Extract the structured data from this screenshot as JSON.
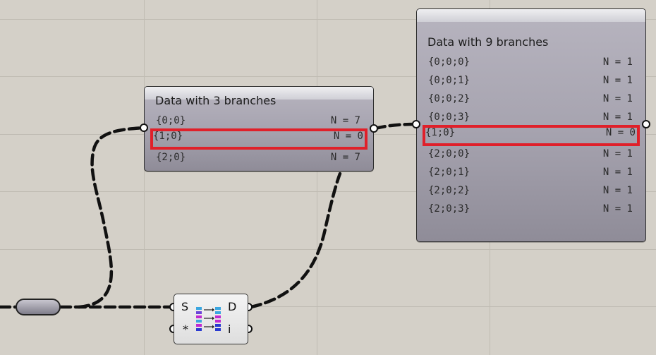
{
  "panel_small": {
    "title": "Data with 3 branches",
    "rows": [
      {
        "path": "{0;0}",
        "count": "N = 7",
        "highlighted": false
      },
      {
        "path": "{1;0}",
        "count": "N = 0",
        "highlighted": true
      },
      {
        "path": "{2;0}",
        "count": "N = 7",
        "highlighted": false
      }
    ]
  },
  "panel_large": {
    "title": "Data with 9 branches",
    "rows": [
      {
        "path": "{0;0;0}",
        "count": "N = 1",
        "highlighted": false
      },
      {
        "path": "{0;0;1}",
        "count": "N = 1",
        "highlighted": false
      },
      {
        "path": "{0;0;2}",
        "count": "N = 1",
        "highlighted": false
      },
      {
        "path": "{0;0;3}",
        "count": "N = 1",
        "highlighted": false
      },
      {
        "path": "{1;0}",
        "count": "N = 0",
        "highlighted": true
      },
      {
        "path": "{2;0;0}",
        "count": "N = 1",
        "highlighted": false
      },
      {
        "path": "{2;0;1}",
        "count": "N = 1",
        "highlighted": false
      },
      {
        "path": "{2;0;2}",
        "count": "N = 1",
        "highlighted": false
      },
      {
        "path": "{2;0;3}",
        "count": "N = 1",
        "highlighted": false
      }
    ]
  },
  "component": {
    "input_s": "S",
    "input_star": "*",
    "output_d": "D",
    "output_i": "i"
  },
  "colors": {
    "canvas": "#d4d0c8",
    "highlight": "#e0202a",
    "wire": "#111111"
  }
}
